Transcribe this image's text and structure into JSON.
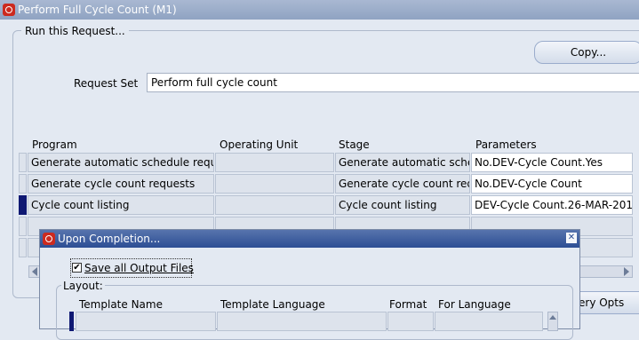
{
  "window": {
    "title": "Perform Full Cycle Count (M1)"
  },
  "run_group": {
    "legend": "Run this Request..."
  },
  "copy_button": "Copy...",
  "request_set": {
    "label": "Request Set",
    "value": "Perform full cycle count"
  },
  "table": {
    "headers": {
      "program": "Program",
      "operating_unit": "Operating Unit",
      "stage": "Stage",
      "parameters": "Parameters"
    },
    "rows": [
      {
        "program": "Generate automatic schedule reque",
        "operating_unit": "",
        "stage": "Generate automatic sche",
        "parameters": "No.DEV-Cycle Count.Yes"
      },
      {
        "program": "Generate cycle count requests",
        "operating_unit": "",
        "stage": "Generate cycle count requ",
        "parameters": "No.DEV-Cycle Count"
      },
      {
        "program": "Cycle count listing",
        "operating_unit": "",
        "stage": "Cycle count listing",
        "parameters": "DEV-Cycle Count.26-MAR-201"
      }
    ]
  },
  "delivery_opts_button": "ery Opts",
  "dialog": {
    "title": "Upon Completion...",
    "save_output": {
      "label": "Save all Output Files",
      "checked": true
    },
    "layout_legend": "Layout:",
    "columns": {
      "template_name": "Template Name",
      "template_language": "Template Language",
      "format": "Format",
      "for_language": "For Language"
    }
  }
}
